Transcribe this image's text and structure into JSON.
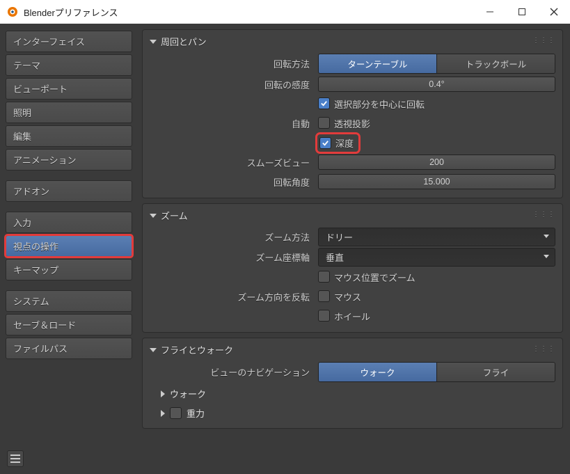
{
  "window": {
    "title": "Blenderプリファレンス"
  },
  "sidebar": {
    "groups": [
      [
        "インターフェイス",
        "テーマ",
        "ビューポート",
        "照明",
        "編集",
        "アニメーション"
      ],
      [
        "アドオン"
      ],
      [
        "入力",
        "視点の操作",
        "キーマップ"
      ],
      [
        "システム",
        "セーブ＆ロード",
        "ファイルパス"
      ]
    ],
    "active": "視点の操作",
    "highlighted": "視点の操作"
  },
  "orbit": {
    "title": "周回とパン",
    "rotation_method_label": "回転方法",
    "rotation_methods": [
      "ターンテーブル",
      "トラックボール"
    ],
    "rotation_method_active": "ターンテーブル",
    "sensitivity_label": "回転の感度",
    "sensitivity_value": "0.4°",
    "orbit_selection_label": "選択部分を中心に回転",
    "orbit_selection_checked": true,
    "auto_label": "自動",
    "perspective_label": "透視投影",
    "perspective_checked": false,
    "depth_label": "深度",
    "depth_checked": true,
    "depth_highlight": true,
    "smooth_view_label": "スムーズビュー",
    "smooth_view_value": "200",
    "rotation_angle_label": "回転角度",
    "rotation_angle_value": "15.000"
  },
  "zoom": {
    "title": "ズーム",
    "method_label": "ズーム方法",
    "method_value": "ドリー",
    "axis_label": "ズーム座標軸",
    "axis_value": "垂直",
    "mouse_pos_label": "マウス位置でズーム",
    "mouse_pos_checked": false,
    "invert_label": "ズーム方向を反転",
    "mouse_label": "マウス",
    "mouse_checked": false,
    "wheel_label": "ホイール",
    "wheel_checked": false
  },
  "fly": {
    "title": "フライとウォーク",
    "nav_label": "ビューのナビゲーション",
    "nav_options": [
      "ウォーク",
      "フライ"
    ],
    "nav_active": "ウォーク",
    "walk_label": "ウォーク",
    "gravity_label": "重力",
    "gravity_checked": false
  }
}
